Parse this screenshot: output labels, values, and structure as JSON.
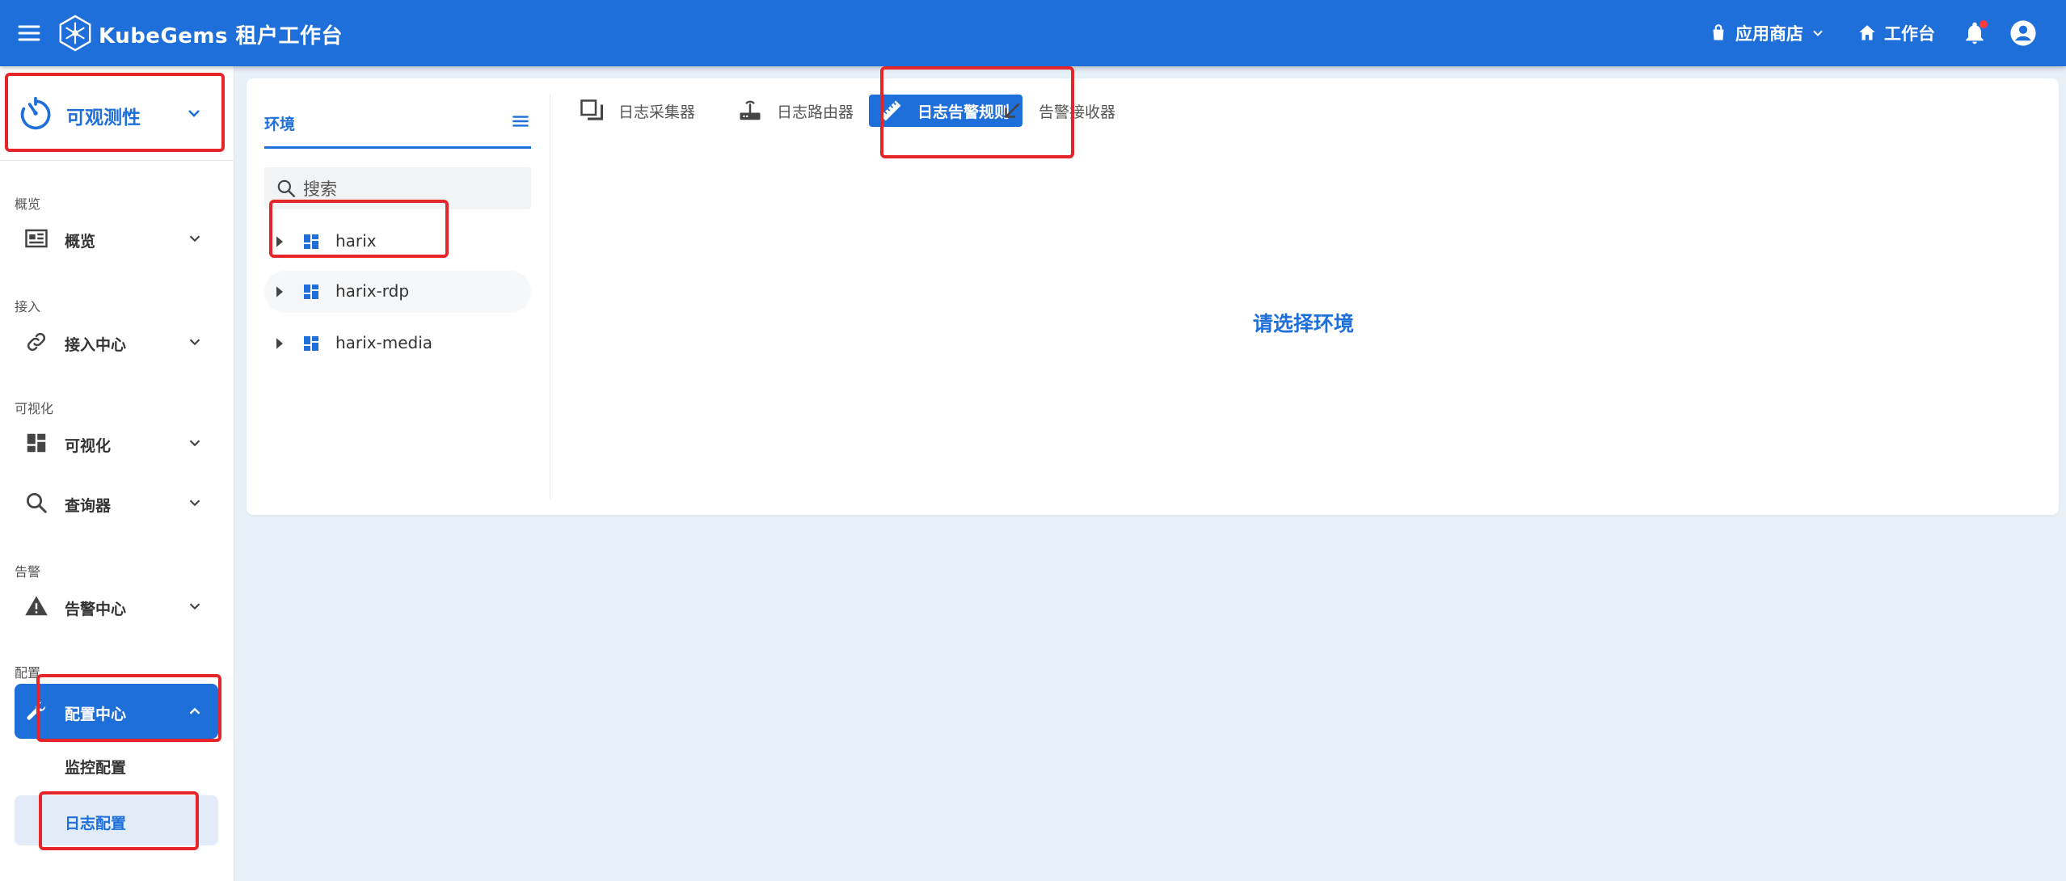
{
  "app": {
    "brand": "KubeGems 租户工作台"
  },
  "topbar": {
    "app_store": "应用商店",
    "workbench": "工作台",
    "notification_badge": true
  },
  "sidebar": {
    "section": "可观测性",
    "groups": [
      {
        "label": "概览",
        "items": [
          {
            "label": "概览",
            "icon": "newspaper-icon",
            "expand": "collapsed"
          }
        ]
      },
      {
        "label": "接入",
        "items": [
          {
            "label": "接入中心",
            "icon": "link-icon",
            "expand": "collapsed"
          }
        ]
      },
      {
        "label": "可视化",
        "items": [
          {
            "label": "可视化",
            "icon": "dashboard-icon",
            "expand": "collapsed"
          },
          {
            "label": "查询器",
            "icon": "search-icon",
            "expand": "collapsed"
          }
        ]
      },
      {
        "label": "告警",
        "items": [
          {
            "label": "告警中心",
            "icon": "alert-icon",
            "expand": "collapsed"
          }
        ]
      },
      {
        "label": "配置",
        "items": [
          {
            "label": "配置中心",
            "icon": "wrench-icon",
            "expand": "expanded",
            "active": true
          }
        ]
      }
    ],
    "sub_items": [
      {
        "label": "监控配置",
        "selected": false
      },
      {
        "label": "日志配置",
        "selected": true
      }
    ]
  },
  "env_panel": {
    "title": "环境",
    "search_placeholder": "搜索",
    "environments": [
      "harix",
      "harix-rdp",
      "harix-media"
    ]
  },
  "tabs": [
    {
      "label": "日志采集器",
      "icon": "collector-icon",
      "active": false
    },
    {
      "label": "日志路由器",
      "icon": "router-icon",
      "active": false
    },
    {
      "label": "日志告警规则",
      "icon": "ruler-icon",
      "active": true
    },
    {
      "label": "告警接收器",
      "icon": "arrow-bottom-left-icon",
      "active": false
    }
  ],
  "main": {
    "empty_message": "请选择环境"
  },
  "colors": {
    "primary": "#1e6fd9",
    "annotation": "#e4262b",
    "background": "#e8f0f8"
  }
}
